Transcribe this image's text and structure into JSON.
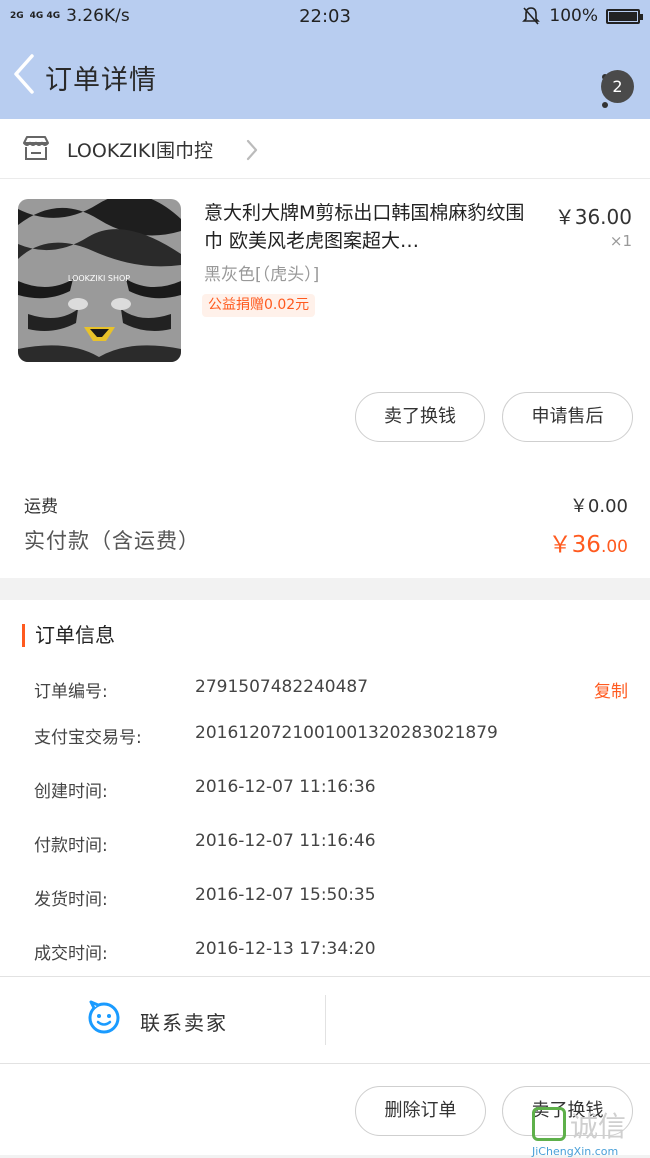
{
  "status_bar": {
    "signal_1": "2G",
    "signal_2": "4G 4G",
    "speed": "3.26K/s",
    "time": "22:03",
    "battery": "100%"
  },
  "header": {
    "title": "订单详情",
    "badge_count": "2"
  },
  "shop": {
    "name": "LOOKZIKI围巾控"
  },
  "product": {
    "title": "意大利大牌M剪标出口韩国棉麻豹纹围巾 欧美风老虎图案超大…",
    "spec": "黑灰色[（虎头）]",
    "charity": "公益捐赠0.02元",
    "price": "￥36.00",
    "qty": "×1",
    "image_text": "LOOKZIKI SHOP"
  },
  "buttons": {
    "sell_exchange": "卖了换钱",
    "after_sale": "申请售后",
    "delete_order": "删除订单",
    "sell_exchange_2": "卖了换钱"
  },
  "fees": {
    "shipping_label": "运费",
    "shipping_value": "￥0.00",
    "total_label": "实付款（含运费）",
    "total_main": "￥36",
    "total_decimal": ".00"
  },
  "order_info": {
    "section_title": "订单信息",
    "copy": "复制",
    "rows": [
      {
        "label": "订单编号:",
        "value": "2791507482240487"
      },
      {
        "label": "支付宝交易号:",
        "value": "2016120721001001320283021879"
      },
      {
        "label": "创建时间:",
        "value": "2016-12-07 11:16:36"
      },
      {
        "label": "付款时间:",
        "value": "2016-12-07 11:16:46"
      },
      {
        "label": "发货时间:",
        "value": "2016-12-07 15:50:35"
      },
      {
        "label": "成交时间:",
        "value": "2016-12-13 17:34:20"
      }
    ]
  },
  "contact": {
    "label": "联系卖家"
  },
  "watermark": {
    "text": "诚信",
    "url": "JiChengXin.com"
  },
  "colors": {
    "header_bg": "#b8cdf0",
    "accent": "#ff5a1f"
  }
}
